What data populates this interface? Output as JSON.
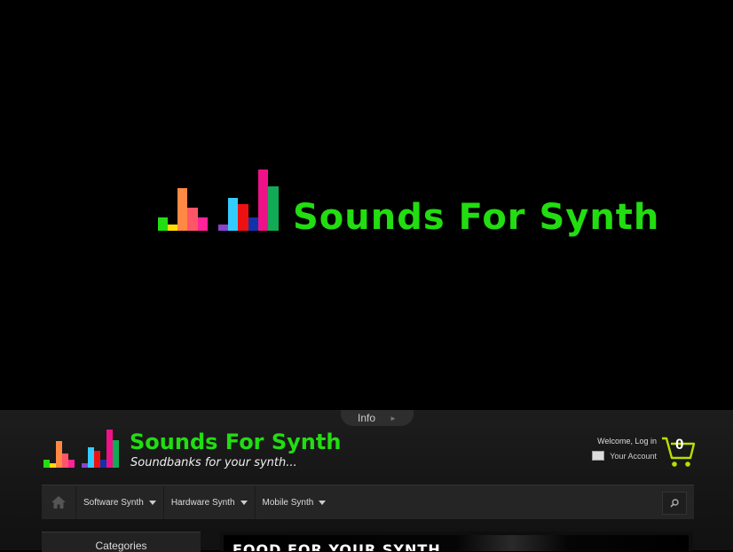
{
  "hero": {
    "logo_title": "Sounds For Synth",
    "logo_bar_colors": [
      "#22dd11",
      "#ffdd00",
      "#ff8844",
      "#ff5566",
      "#ff2299",
      "#8844cc",
      "#33ccff",
      "#ee1111",
      "#1133aa",
      "#ee1188",
      "#11aa55"
    ]
  },
  "header": {
    "info_label": "Info",
    "brand_title": "Sounds For Synth",
    "brand_tagline": "Soundbanks for your synth...",
    "welcome_text": "Welcome, Log in",
    "account_link": "Your Account",
    "cart_count": "0",
    "accent_color": "#22dd11"
  },
  "nav": {
    "home_icon": "home-icon",
    "items": [
      {
        "label": "Software Synth"
      },
      {
        "label": "Hardware Synth"
      },
      {
        "label": "Mobile Synth"
      }
    ],
    "search_icon": "search-icon"
  },
  "sidebar": {
    "categories_title": "Categories"
  },
  "banner": {
    "text": "FOOD FOR YOUR SYNTH"
  }
}
